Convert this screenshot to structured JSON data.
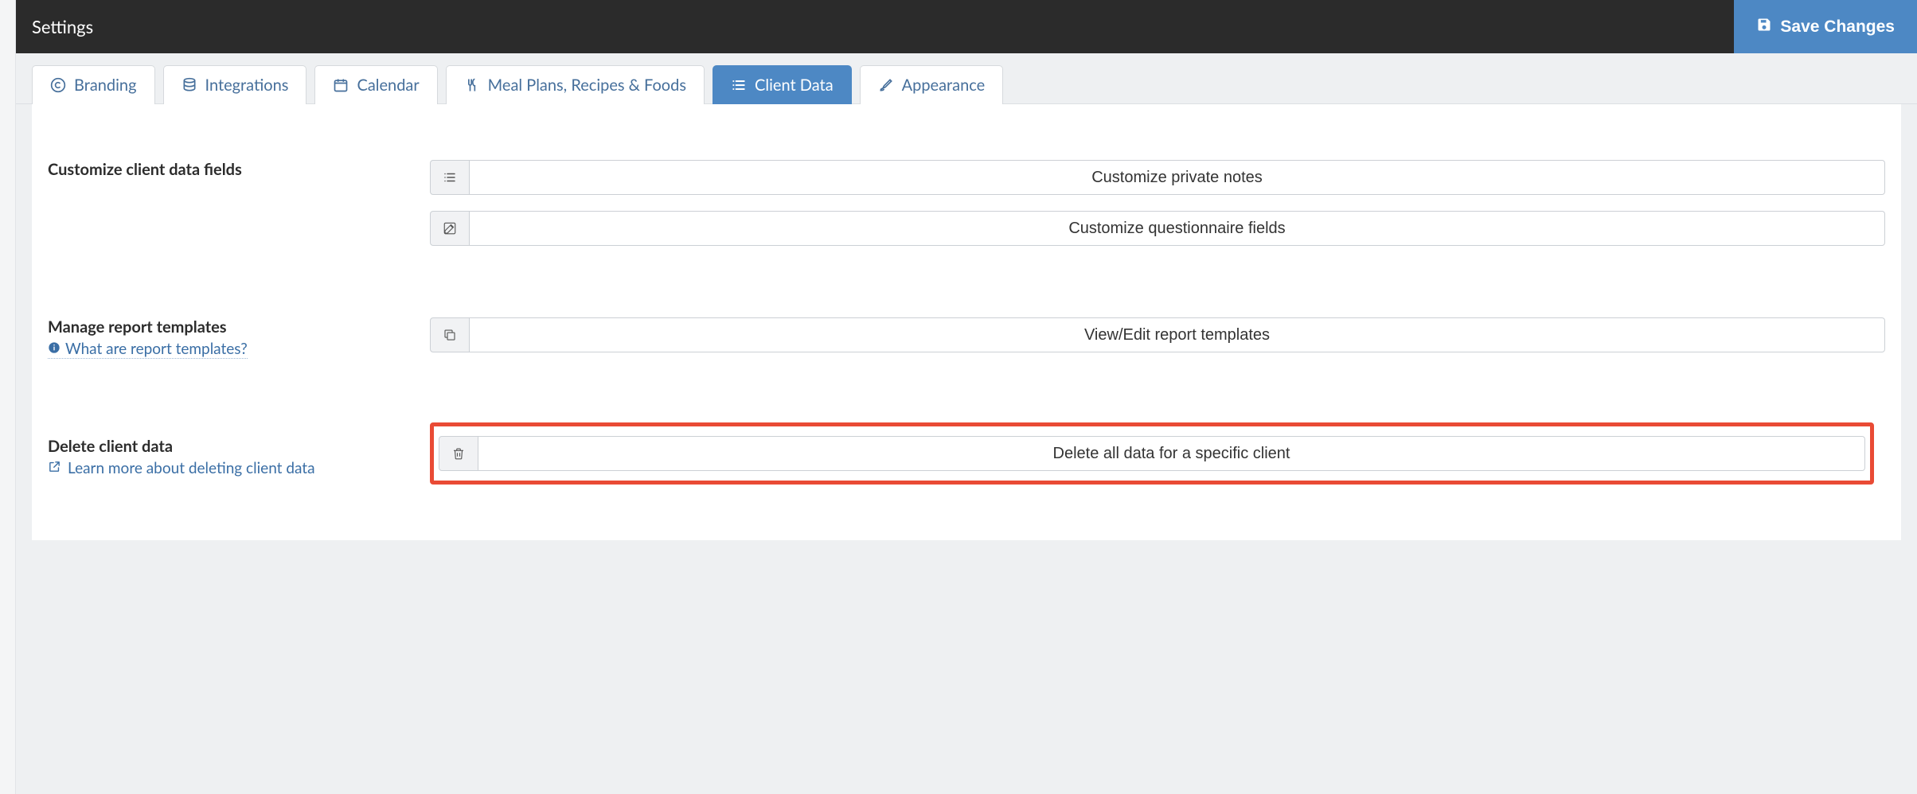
{
  "header": {
    "title": "Settings",
    "save_label": "Save Changes"
  },
  "tabs": {
    "branding": "Branding",
    "integrations": "Integrations",
    "calendar": "Calendar",
    "mealplans": "Meal Plans, Recipes & Foods",
    "clientdata": "Client Data",
    "appearance": "Appearance"
  },
  "sections": {
    "customize": {
      "heading": "Customize client data fields",
      "private_notes_btn": "Customize private notes",
      "questionnaire_btn": "Customize questionnaire fields"
    },
    "reports": {
      "heading": "Manage report templates",
      "help_link": "What are report templates?",
      "view_btn": "View/Edit report templates"
    },
    "delete": {
      "heading": "Delete client data",
      "help_link": "Learn more about deleting client data",
      "delete_btn": "Delete all data for a specific client"
    }
  }
}
